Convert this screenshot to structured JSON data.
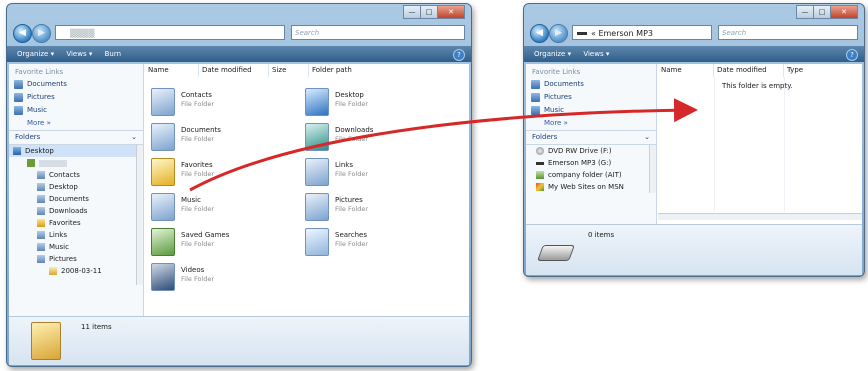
{
  "win1": {
    "address": "▒▒▒▒",
    "search_placeholder": "Search",
    "toolbar": {
      "organize": "Organize ▾",
      "views": "Views ▾",
      "burn": "Burn",
      "help": "?"
    },
    "nav": {
      "favorites_header": "Favorite Links",
      "links": [
        "Documents",
        "Pictures",
        "Music"
      ],
      "more": "More »",
      "folders_header": "Folders",
      "tree": [
        "Desktop",
        "",
        "Contacts",
        "Desktop",
        "Documents",
        "Downloads",
        "Favorites",
        "Links",
        "Music",
        "Pictures",
        "2008-03-11"
      ]
    },
    "columns": [
      "Name",
      "Date modified",
      "Size",
      "Folder path"
    ],
    "items_left": [
      {
        "name": "Contacts",
        "type": "File Folder"
      },
      {
        "name": "Documents",
        "type": "File Folder"
      },
      {
        "name": "Favorites",
        "type": "File Folder"
      },
      {
        "name": "Music",
        "type": "File Folder"
      },
      {
        "name": "Saved Games",
        "type": "File Folder"
      },
      {
        "name": "Videos",
        "type": "File Folder"
      }
    ],
    "items_right": [
      {
        "name": "Desktop",
        "type": "File Folder"
      },
      {
        "name": "Downloads",
        "type": "File Folder"
      },
      {
        "name": "Links",
        "type": "File Folder"
      },
      {
        "name": "Pictures",
        "type": "File Folder"
      },
      {
        "name": "Searches",
        "type": "File Folder"
      }
    ],
    "status": "11 items"
  },
  "win2": {
    "address": "« Emerson MP3",
    "search_placeholder": "Search",
    "toolbar": {
      "organize": "Organize ▾",
      "views": "Views ▾",
      "help": "?"
    },
    "nav": {
      "favorites_header": "Favorite Links",
      "links": [
        "Documents",
        "Pictures",
        "Music"
      ],
      "more": "More »",
      "folders_header": "Folders",
      "tree": [
        "DVD RW Drive (F:)",
        "Emerson MP3 (G:)",
        "company folder (AIT)",
        "My Web Sites on MSN"
      ]
    },
    "columns": [
      "Name",
      "Date modified",
      "Type"
    ],
    "empty_message": "This folder is empty.",
    "status": "0 items"
  },
  "colors": {
    "arrow": "#d62828",
    "toolbar": "#3f6e9b",
    "frame": "#9dbfe0"
  }
}
